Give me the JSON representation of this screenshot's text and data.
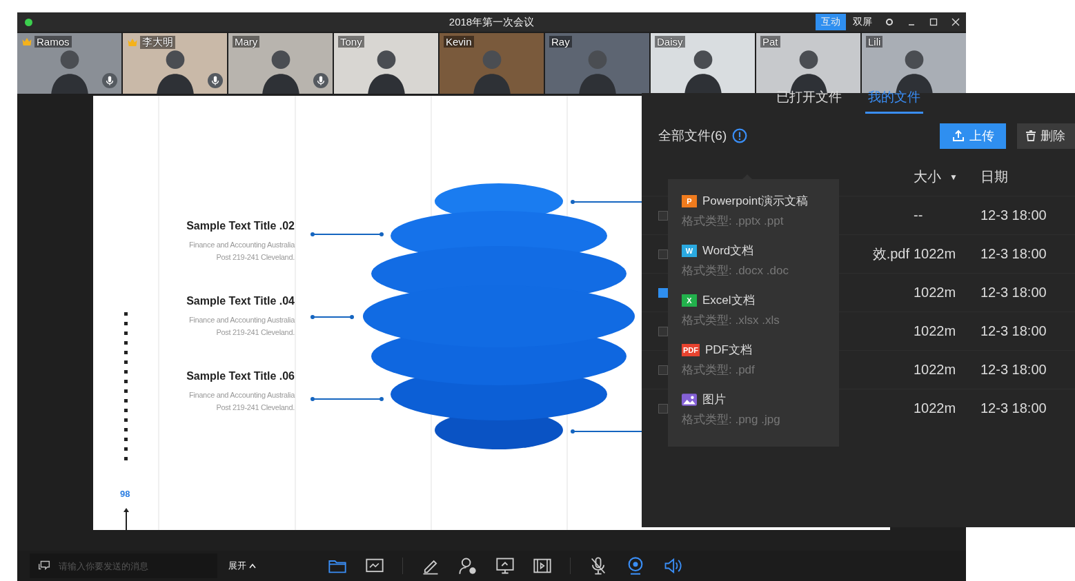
{
  "window": {
    "title": "2018年第一次会议",
    "modes": [
      {
        "label": "互动",
        "selected": true
      },
      {
        "label": "双屏",
        "selected": false
      }
    ]
  },
  "participants": [
    {
      "name": "Ramos",
      "host": true,
      "mic": true
    },
    {
      "name": "李大明",
      "host": true,
      "mic": true
    },
    {
      "name": "Mary",
      "host": false,
      "mic": true
    },
    {
      "name": "Tony",
      "host": false,
      "mic": false
    },
    {
      "name": "Kevin",
      "host": false,
      "mic": false
    },
    {
      "name": "Ray",
      "host": false,
      "mic": false
    },
    {
      "name": "Daisy",
      "host": false,
      "mic": false
    },
    {
      "name": "Pat",
      "host": false,
      "mic": false
    },
    {
      "name": "Lili",
      "host": false,
      "mic": false
    }
  ],
  "slide": {
    "items": [
      {
        "title": "Sample Text Title .02",
        "lines": [
          "Finance and Accounting Australia",
          "Post 219-241 Cleveland."
        ]
      },
      {
        "title": "Sample Text Title .04",
        "lines": [
          "Finance and Accounting Australia",
          "Post 219-241 Cleveland."
        ]
      },
      {
        "title": "Sample Text Title .06",
        "lines": [
          "Finance and Accounting Australia",
          "Post 219-241 Cleveland."
        ]
      }
    ],
    "page": "98"
  },
  "file_panel": {
    "tabs": [
      {
        "label": "已打开文件",
        "selected": false
      },
      {
        "label": "我的文件",
        "selected": true
      }
    ],
    "heading": "全部文件(6)",
    "upload": "上传",
    "delete": "删除",
    "columns": {
      "size": "大小",
      "sort": "▼",
      "date": "日期"
    },
    "rows": [
      {
        "size": "--",
        "date": "12-3 18:00",
        "checked": false
      },
      {
        "name": "效.pdf",
        "size": "1022m",
        "date": "12-3 18:00",
        "checked": false
      },
      {
        "size": "1022m",
        "date": "12-3 18:00",
        "checked": true
      },
      {
        "size": "1022m",
        "date": "12-3 18:00",
        "checked": false
      },
      {
        "size": "1022m",
        "date": "12-3 18:00",
        "checked": false
      },
      {
        "size": "1022m",
        "date": "12-3 18:00",
        "checked": false
      }
    ],
    "type_popover": [
      {
        "kind": "ppt",
        "badge": "P",
        "name": "Powerpoint演示文稿",
        "formats": "格式类型: .pptx .ppt"
      },
      {
        "kind": "word",
        "badge": "W",
        "name": "Word文档",
        "formats": "格式类型: .docx .doc"
      },
      {
        "kind": "excel",
        "badge": "X",
        "name": "Excel文档",
        "formats": "格式类型: .xlsx .xls"
      },
      {
        "kind": "pdf",
        "badge": "PDF",
        "name": "PDF文档",
        "formats": "格式类型: .pdf"
      },
      {
        "kind": "image",
        "name": "图片",
        "formats": "格式类型: .png .jpg"
      }
    ]
  },
  "chat": {
    "placeholder": "请输入你要发送的消息",
    "expand": "展开"
  },
  "toolbar": [
    {
      "kind": "files",
      "active": true
    },
    {
      "kind": "whiteboard",
      "active": false
    },
    {
      "kind": "sep"
    },
    {
      "kind": "pen",
      "active": false
    },
    {
      "kind": "participants",
      "active": false
    },
    {
      "kind": "share",
      "active": false
    },
    {
      "kind": "video",
      "active": false
    },
    {
      "kind": "sep"
    },
    {
      "kind": "mic-off",
      "active": false
    },
    {
      "kind": "camera",
      "active": true
    },
    {
      "kind": "speaker",
      "active": true
    }
  ]
}
